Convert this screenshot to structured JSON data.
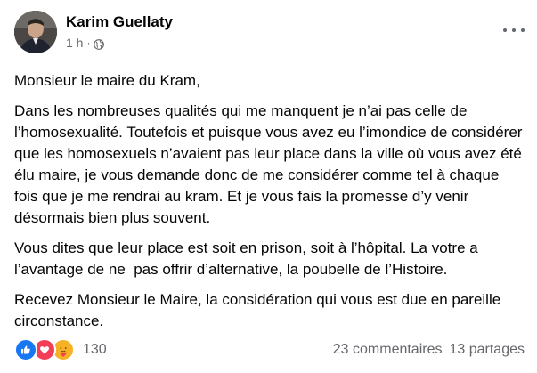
{
  "post": {
    "author": "Karim Guellaty",
    "time": "1 h",
    "separator": "·",
    "visibility_icon": "globe-icon",
    "more_icon": "more-options-icon",
    "paragraphs": [
      "Monsieur le maire du Kram,",
      "Dans les nombreuses qualités qui me manquent je n’ai pas celle de l’homosexualité. Toutefois et puisque vous avez eu l’imondice de considérer que les homosexuels n’avaient pas leur place dans la ville où vous avez été élu maire, je vous demande donc de me considérer comme tel à chaque fois que je me rendrai au kram. Et je vous fais la promesse d’y venir désormais bien plus souvent.",
      "Vous dites que leur place est soit en prison, soit à l’hôpital. La votre a l’avantage de ne  pas offrir d’alternative, la poubelle de l’Histoire.",
      "Recevez Monsieur le Maire, la considération qui vous est due en pareille circonstance."
    ]
  },
  "footer": {
    "reactions": [
      "like-icon",
      "love-icon",
      "care-icon"
    ],
    "reaction_count": "130",
    "comments": "23 commentaires",
    "shares": "13 partages"
  },
  "colors": {
    "text": "#050505",
    "secondary": "#65676b",
    "like": "#1877f2",
    "love": "#f33e58",
    "care": "#f7b125"
  }
}
